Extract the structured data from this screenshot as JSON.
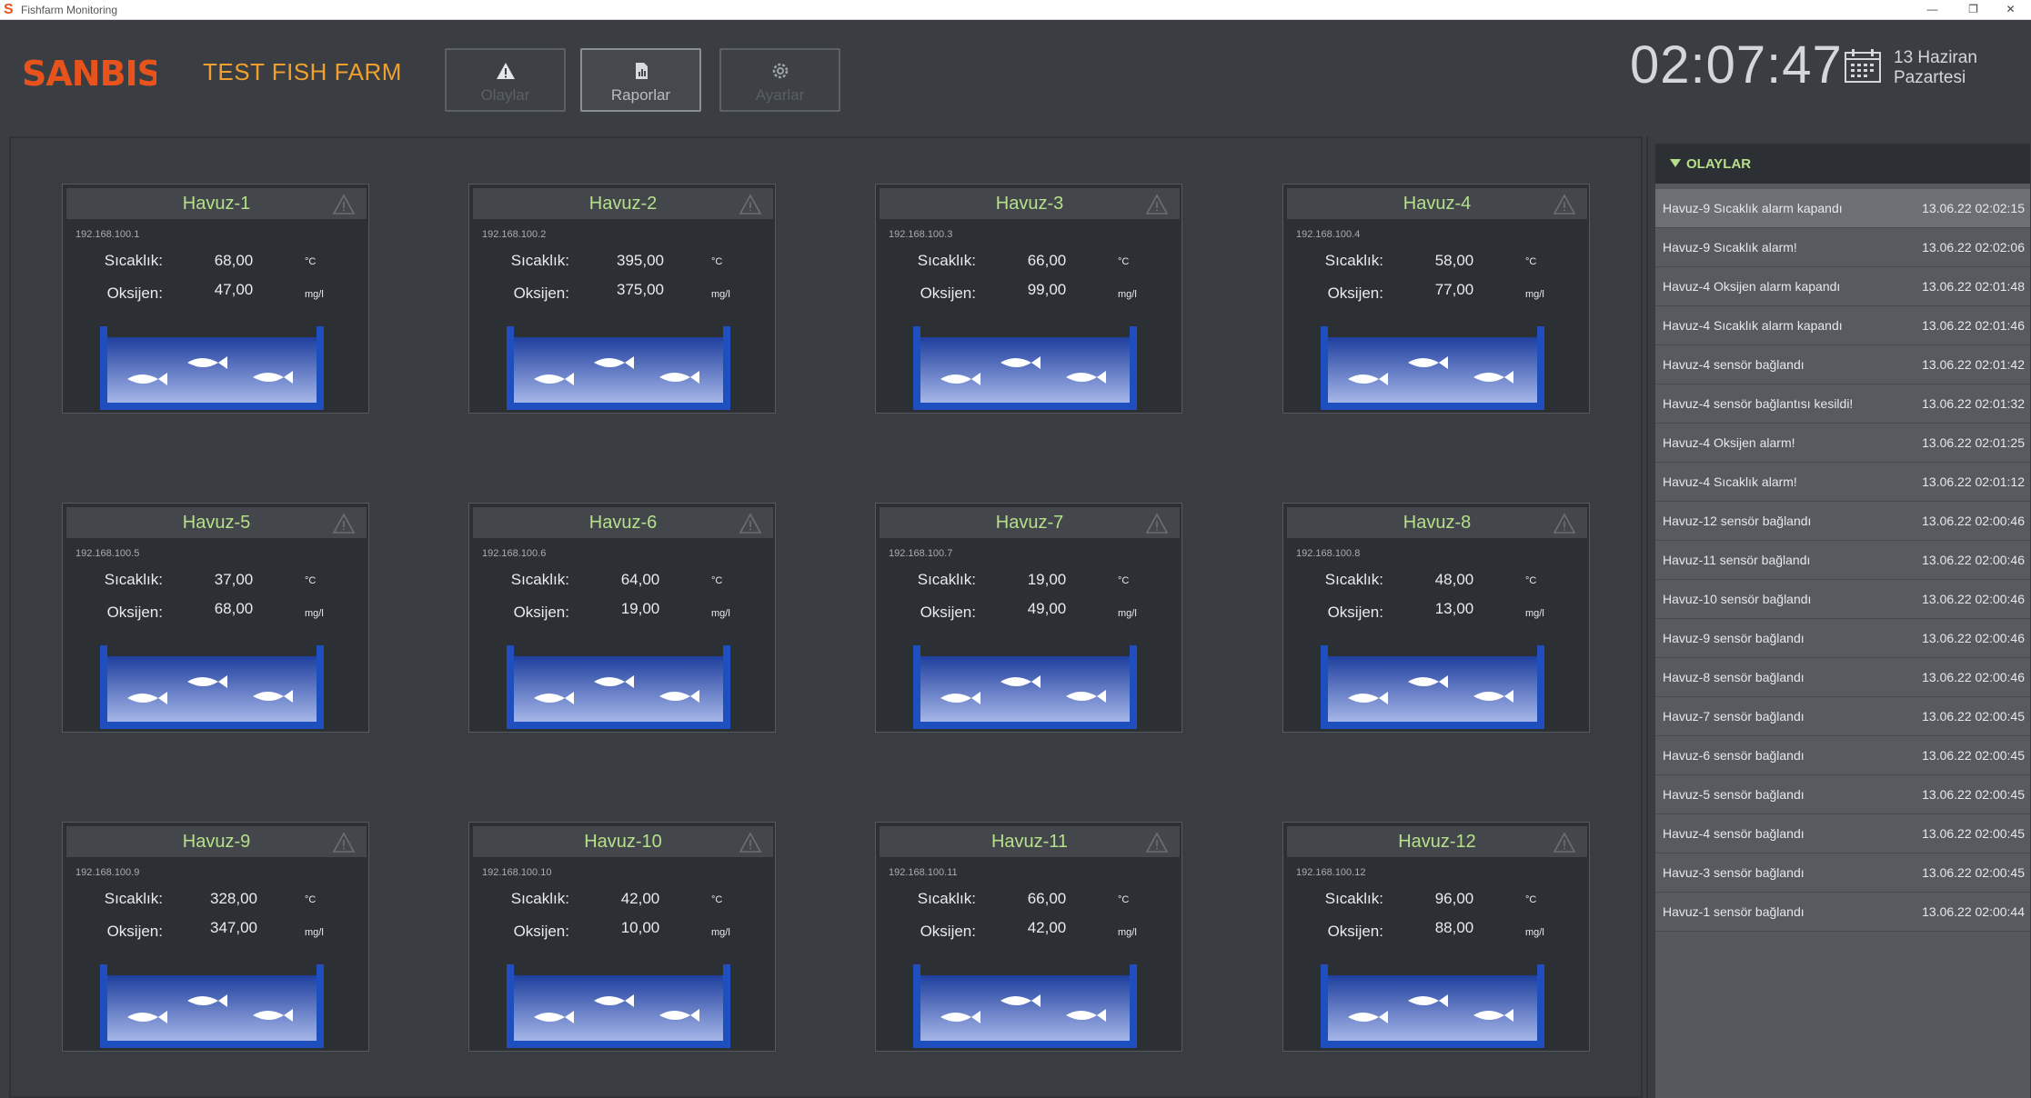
{
  "window": {
    "title": "Fishfarm Monitoring",
    "minimize": "—",
    "restore": "❐",
    "close": "✕"
  },
  "header": {
    "logo_text": "SANBIS",
    "farm_name": "TEST FISH FARM",
    "buttons": [
      {
        "label": "Olaylar",
        "icon": "warning-icon",
        "active": false
      },
      {
        "label": "Raporlar",
        "icon": "report-icon",
        "active": true
      },
      {
        "label": "Ayarlar",
        "icon": "gear-icon",
        "active": false
      }
    ],
    "clock": "02:07:47",
    "date_line1": "13 Haziran",
    "date_line2": "Pazartesi"
  },
  "labels": {
    "temperature": "Sıcaklık:",
    "oxygen": "Oksijen:",
    "temp_unit": "°C",
    "oxy_unit": "mg/l"
  },
  "pools": [
    {
      "name": "Havuz-1",
      "ip": "192.168.100.1",
      "temp": "68,00",
      "oxy": "47,00"
    },
    {
      "name": "Havuz-2",
      "ip": "192.168.100.2",
      "temp": "395,00",
      "oxy": "375,00"
    },
    {
      "name": "Havuz-3",
      "ip": "192.168.100.3",
      "temp": "66,00",
      "oxy": "99,00"
    },
    {
      "name": "Havuz-4",
      "ip": "192.168.100.4",
      "temp": "58,00",
      "oxy": "77,00"
    },
    {
      "name": "Havuz-5",
      "ip": "192.168.100.5",
      "temp": "37,00",
      "oxy": "68,00"
    },
    {
      "name": "Havuz-6",
      "ip": "192.168.100.6",
      "temp": "64,00",
      "oxy": "19,00"
    },
    {
      "name": "Havuz-7",
      "ip": "192.168.100.7",
      "temp": "19,00",
      "oxy": "49,00"
    },
    {
      "name": "Havuz-8",
      "ip": "192.168.100.8",
      "temp": "48,00",
      "oxy": "13,00"
    },
    {
      "name": "Havuz-9",
      "ip": "192.168.100.9",
      "temp": "328,00",
      "oxy": "347,00"
    },
    {
      "name": "Havuz-10",
      "ip": "192.168.100.10",
      "temp": "42,00",
      "oxy": "10,00"
    },
    {
      "name": "Havuz-11",
      "ip": "192.168.100.11",
      "temp": "66,00",
      "oxy": "42,00"
    },
    {
      "name": "Havuz-12",
      "ip": "192.168.100.12",
      "temp": "96,00",
      "oxy": "88,00"
    }
  ],
  "events": {
    "title": "OLAYLAR",
    "items": [
      {
        "msg": "Havuz-9 Sıcaklık alarm kapandı",
        "time": "13.06.22 02:02:15",
        "selected": true
      },
      {
        "msg": "Havuz-9 Sıcaklık alarm!",
        "time": "13.06.22 02:02:06"
      },
      {
        "msg": "Havuz-4 Oksijen alarm kapandı",
        "time": "13.06.22 02:01:48"
      },
      {
        "msg": "Havuz-4 Sıcaklık alarm kapandı",
        "time": "13.06.22 02:01:46"
      },
      {
        "msg": "Havuz-4 sensör bağlandı",
        "time": "13.06.22 02:01:42"
      },
      {
        "msg": "Havuz-4 sensör bağlantısı kesildi!",
        "time": "13.06.22 02:01:32"
      },
      {
        "msg": "Havuz-4 Oksijen alarm!",
        "time": "13.06.22 02:01:25"
      },
      {
        "msg": "Havuz-4 Sıcaklık alarm!",
        "time": "13.06.22 02:01:12"
      },
      {
        "msg": "Havuz-12 sensör bağlandı",
        "time": "13.06.22 02:00:46"
      },
      {
        "msg": "Havuz-11 sensör bağlandı",
        "time": "13.06.22 02:00:46"
      },
      {
        "msg": "Havuz-10 sensör bağlandı",
        "time": "13.06.22 02:00:46"
      },
      {
        "msg": "Havuz-9 sensör bağlandı",
        "time": "13.06.22 02:00:46"
      },
      {
        "msg": "Havuz-8 sensör bağlandı",
        "time": "13.06.22 02:00:46"
      },
      {
        "msg": "Havuz-7 sensör bağlandı",
        "time": "13.06.22 02:00:45"
      },
      {
        "msg": "Havuz-6 sensör bağlandı",
        "time": "13.06.22 02:00:45"
      },
      {
        "msg": "Havuz-5 sensör bağlandı",
        "time": "13.06.22 02:00:45"
      },
      {
        "msg": "Havuz-4 sensör bağlandı",
        "time": "13.06.22 02:00:45"
      },
      {
        "msg": "Havuz-3 sensör bağlandı",
        "time": "13.06.22 02:00:45"
      },
      {
        "msg": "Havuz-1 sensör bağlandı",
        "time": "13.06.22 02:00:44"
      }
    ]
  },
  "colors": {
    "accent_green": "#b5e08a",
    "brand_orange": "#f0a02c",
    "logo_red": "#e8531c",
    "water_blue": "#1f4fb0"
  }
}
